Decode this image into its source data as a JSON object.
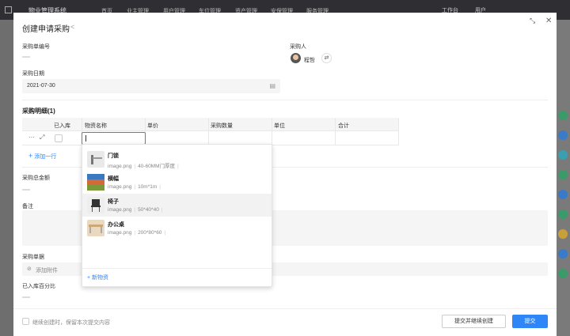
{
  "background": {
    "app_name": "物业管理系统",
    "nav": [
      "首页",
      "业主管理",
      "用户管理",
      "车位管理",
      "资产管理",
      "安保管理",
      "服务管理"
    ],
    "workbench": "工作台",
    "user": "用户"
  },
  "modal": {
    "title": "创建申请采购",
    "fields": {
      "order_no_label": "采购单编号",
      "purchaser_label": "采购人",
      "purchaser_name": "程哲",
      "date_label": "采购日期",
      "date_value": "2021-07-30",
      "details_title": "采购明细(1)",
      "total_label": "采购总金额",
      "remark_label": "备注",
      "attachment_label": "采购单据",
      "attachment_button": "添加附件",
      "warehoused_percent_label": "已入库百分比"
    },
    "table": {
      "headers": [
        "已入库",
        "物资名称",
        "单价",
        "采购数量",
        "单位",
        "合计"
      ],
      "row_actions": {
        "more": "···",
        "expand": "⤢"
      }
    },
    "add_row": "添加一行",
    "dropdown": {
      "options": [
        {
          "name": "门锁",
          "file": "image.png",
          "spec": "40-60MM门厚度",
          "thumb_color": "#e9e9e9"
        },
        {
          "name": "横幅",
          "file": "image.png",
          "spec": "10m*1m",
          "thumb_color": "#c0603a"
        },
        {
          "name": "椅子",
          "file": "image.png",
          "spec": "50*40*40",
          "thumb_color": "#eeeeee"
        },
        {
          "name": "办公桌",
          "file": "image.png",
          "spec": "200*80*60",
          "thumb_color": "#ead9c0"
        }
      ],
      "new_item": "新物资"
    },
    "footer": {
      "keep_label": "继续创建时，保留本次提交内容",
      "submit_continue": "提交并继续创建",
      "submit": "提交"
    }
  },
  "colors": {
    "primary": "#2f86f6"
  }
}
